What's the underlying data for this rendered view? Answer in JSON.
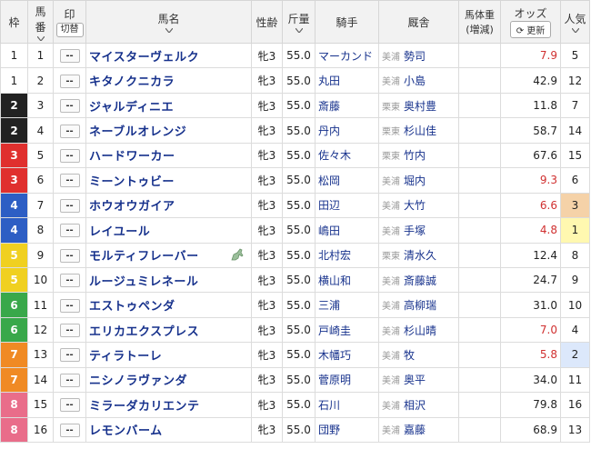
{
  "header": {
    "frame": "枠",
    "number_1": "馬",
    "number_2": "番",
    "mark": "印",
    "mark_toggle": "切替",
    "horse": "馬名",
    "sex_age": "性齢",
    "weight": "斤量",
    "jockey": "騎手",
    "stable": "厩舎",
    "body_weight": "馬体重",
    "body_weight_sub": "(増減)",
    "odds": "オッズ",
    "odds_refresh": "更新",
    "popularity": "人気"
  },
  "colors": {
    "frame1": "#ffffff",
    "frame2": "#222222",
    "frame3": "#e0302e",
    "frame4": "#2d5ec4",
    "frame5": "#f0d020",
    "frame6": "#39a84a",
    "frame7": "#f08a24",
    "frame8": "#e96d8a",
    "link": "#16318c",
    "odds_highlight": "#d03030"
  },
  "rows": [
    {
      "frame": "1",
      "num": "1",
      "mark": "--",
      "horse": "マイスターヴェルク",
      "sex_age": "牝3",
      "weight": "55.0",
      "jockey": "マーカンド",
      "loc": "美浦",
      "trainer": "勢司",
      "body": "",
      "odds": "7.9",
      "pop": "5"
    },
    {
      "frame": "1",
      "num": "2",
      "mark": "--",
      "horse": "キタノクニカラ",
      "sex_age": "牝3",
      "weight": "55.0",
      "jockey": "丸田",
      "loc": "美浦",
      "trainer": "小島",
      "body": "",
      "odds": "42.9",
      "pop": "12"
    },
    {
      "frame": "2",
      "num": "3",
      "mark": "--",
      "horse": "ジャルディニエ",
      "sex_age": "牝3",
      "weight": "55.0",
      "jockey": "斎藤",
      "loc": "栗東",
      "trainer": "奥村豊",
      "body": "",
      "odds": "11.8",
      "pop": "7"
    },
    {
      "frame": "2",
      "num": "4",
      "mark": "--",
      "horse": "ネーブルオレンジ",
      "sex_age": "牝3",
      "weight": "55.0",
      "jockey": "丹内",
      "loc": "栗東",
      "trainer": "杉山佳",
      "body": "",
      "odds": "58.7",
      "pop": "14"
    },
    {
      "frame": "3",
      "num": "5",
      "mark": "--",
      "horse": "ハードワーカー",
      "sex_age": "牝3",
      "weight": "55.0",
      "jockey": "佐々木",
      "loc": "栗東",
      "trainer": "竹内",
      "body": "",
      "odds": "67.6",
      "pop": "15"
    },
    {
      "frame": "3",
      "num": "6",
      "mark": "--",
      "horse": "ミーントゥビー",
      "sex_age": "牝3",
      "weight": "55.0",
      "jockey": "松岡",
      "loc": "美浦",
      "trainer": "堀内",
      "body": "",
      "odds": "9.3",
      "pop": "6"
    },
    {
      "frame": "4",
      "num": "7",
      "mark": "--",
      "horse": "ホウオウガイア",
      "sex_age": "牝3",
      "weight": "55.0",
      "jockey": "田辺",
      "loc": "美浦",
      "trainer": "大竹",
      "body": "",
      "odds": "6.6",
      "pop": "3"
    },
    {
      "frame": "4",
      "num": "8",
      "mark": "--",
      "horse": "レイユール",
      "sex_age": "牝3",
      "weight": "55.0",
      "jockey": "嶋田",
      "loc": "美浦",
      "trainer": "手塚",
      "body": "",
      "odds": "4.8",
      "pop": "1"
    },
    {
      "frame": "5",
      "num": "9",
      "mark": "--",
      "horse": "モルティフレーバー",
      "sex_age": "牝3",
      "weight": "55.0",
      "jockey": "北村宏",
      "loc": "栗東",
      "trainer": "清水久",
      "body": "",
      "odds": "12.4",
      "pop": "8"
    },
    {
      "frame": "5",
      "num": "10",
      "mark": "--",
      "horse": "ルージュミレネール",
      "sex_age": "牝3",
      "weight": "55.0",
      "jockey": "横山和",
      "loc": "美浦",
      "trainer": "斎藤誠",
      "body": "",
      "odds": "24.7",
      "pop": "9"
    },
    {
      "frame": "6",
      "num": "11",
      "mark": "--",
      "horse": "エストゥペンダ",
      "sex_age": "牝3",
      "weight": "55.0",
      "jockey": "三浦",
      "loc": "美浦",
      "trainer": "高柳瑞",
      "body": "",
      "odds": "31.0",
      "pop": "10"
    },
    {
      "frame": "6",
      "num": "12",
      "mark": "--",
      "horse": "エリカエクスプレス",
      "sex_age": "牝3",
      "weight": "55.0",
      "jockey": "戸崎圭",
      "loc": "美浦",
      "trainer": "杉山晴",
      "body": "",
      "odds": "7.0",
      "pop": "4"
    },
    {
      "frame": "7",
      "num": "13",
      "mark": "--",
      "horse": "ティラトーレ",
      "sex_age": "牝3",
      "weight": "55.0",
      "jockey": "木幡巧",
      "loc": "美浦",
      "trainer": "牧",
      "body": "",
      "odds": "5.8",
      "pop": "2"
    },
    {
      "frame": "7",
      "num": "14",
      "mark": "--",
      "horse": "ニシノラヴァンダ",
      "sex_age": "牝3",
      "weight": "55.0",
      "jockey": "菅原明",
      "loc": "美浦",
      "trainer": "奥平",
      "body": "",
      "odds": "34.0",
      "pop": "11"
    },
    {
      "frame": "8",
      "num": "15",
      "mark": "--",
      "horse": "ミラーダカリエンテ",
      "sex_age": "牝3",
      "weight": "55.0",
      "jockey": "石川",
      "loc": "美浦",
      "trainer": "相沢",
      "body": "",
      "odds": "79.8",
      "pop": "16"
    },
    {
      "frame": "8",
      "num": "16",
      "mark": "--",
      "horse": "レモンバーム",
      "sex_age": "牝3",
      "weight": "55.0",
      "jockey": "団野",
      "loc": "美浦",
      "trainer": "嘉藤",
      "body": "",
      "odds": "68.9",
      "pop": "13"
    }
  ]
}
